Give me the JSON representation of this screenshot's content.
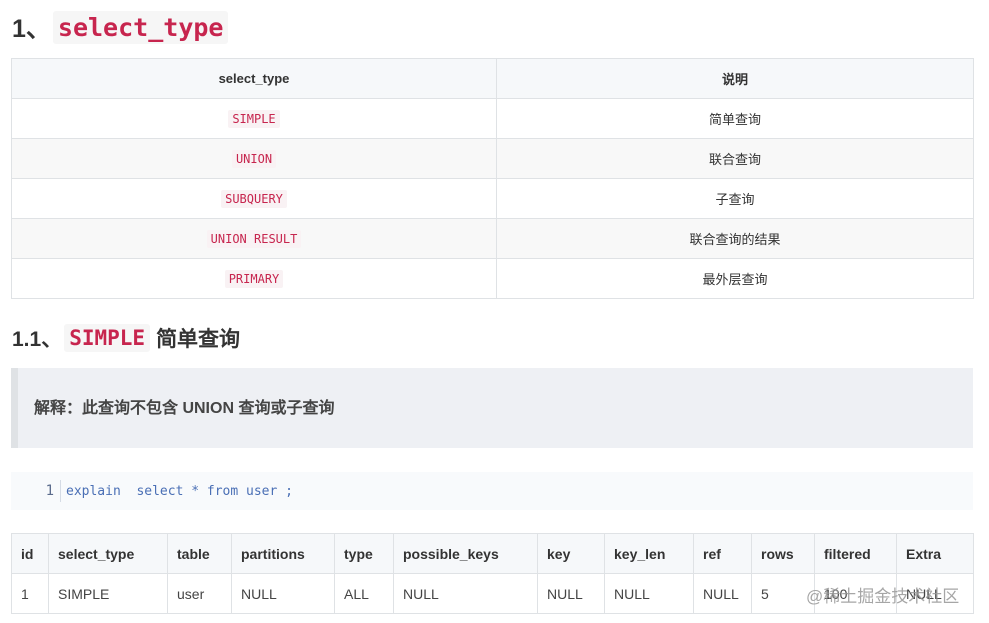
{
  "heading1": {
    "number": "1、",
    "code": "select_type"
  },
  "type_table": {
    "headers": [
      "select_type",
      "说明"
    ],
    "rows": [
      {
        "type": "SIMPLE",
        "desc": "简单查询"
      },
      {
        "type": "UNION",
        "desc": "联合查询"
      },
      {
        "type": "SUBQUERY",
        "desc": "子查询"
      },
      {
        "type": "UNION RESULT",
        "desc": "联合查询的结果"
      },
      {
        "type": "PRIMARY",
        "desc": "最外层查询"
      }
    ]
  },
  "heading2": {
    "number": "1.1、",
    "code": "SIMPLE",
    "text": "简单查询"
  },
  "quote": {
    "text": "解释：此查询不包含 UNION 查询或子查询"
  },
  "codeblock": {
    "line_number": "1",
    "code": "explain  select * from user ;"
  },
  "explain_table": {
    "headers": [
      "id",
      "select_type",
      "table",
      "partitions",
      "type",
      "possible_keys",
      "key",
      "key_len",
      "ref",
      "rows",
      "filtered",
      "Extra"
    ],
    "row": [
      "1",
      "SIMPLE",
      "user",
      "NULL",
      "ALL",
      "NULL",
      "NULL",
      "NULL",
      "NULL",
      "5",
      "100",
      "NULL"
    ]
  },
  "watermark": {
    "text": "@稀土掘金技术社区"
  }
}
